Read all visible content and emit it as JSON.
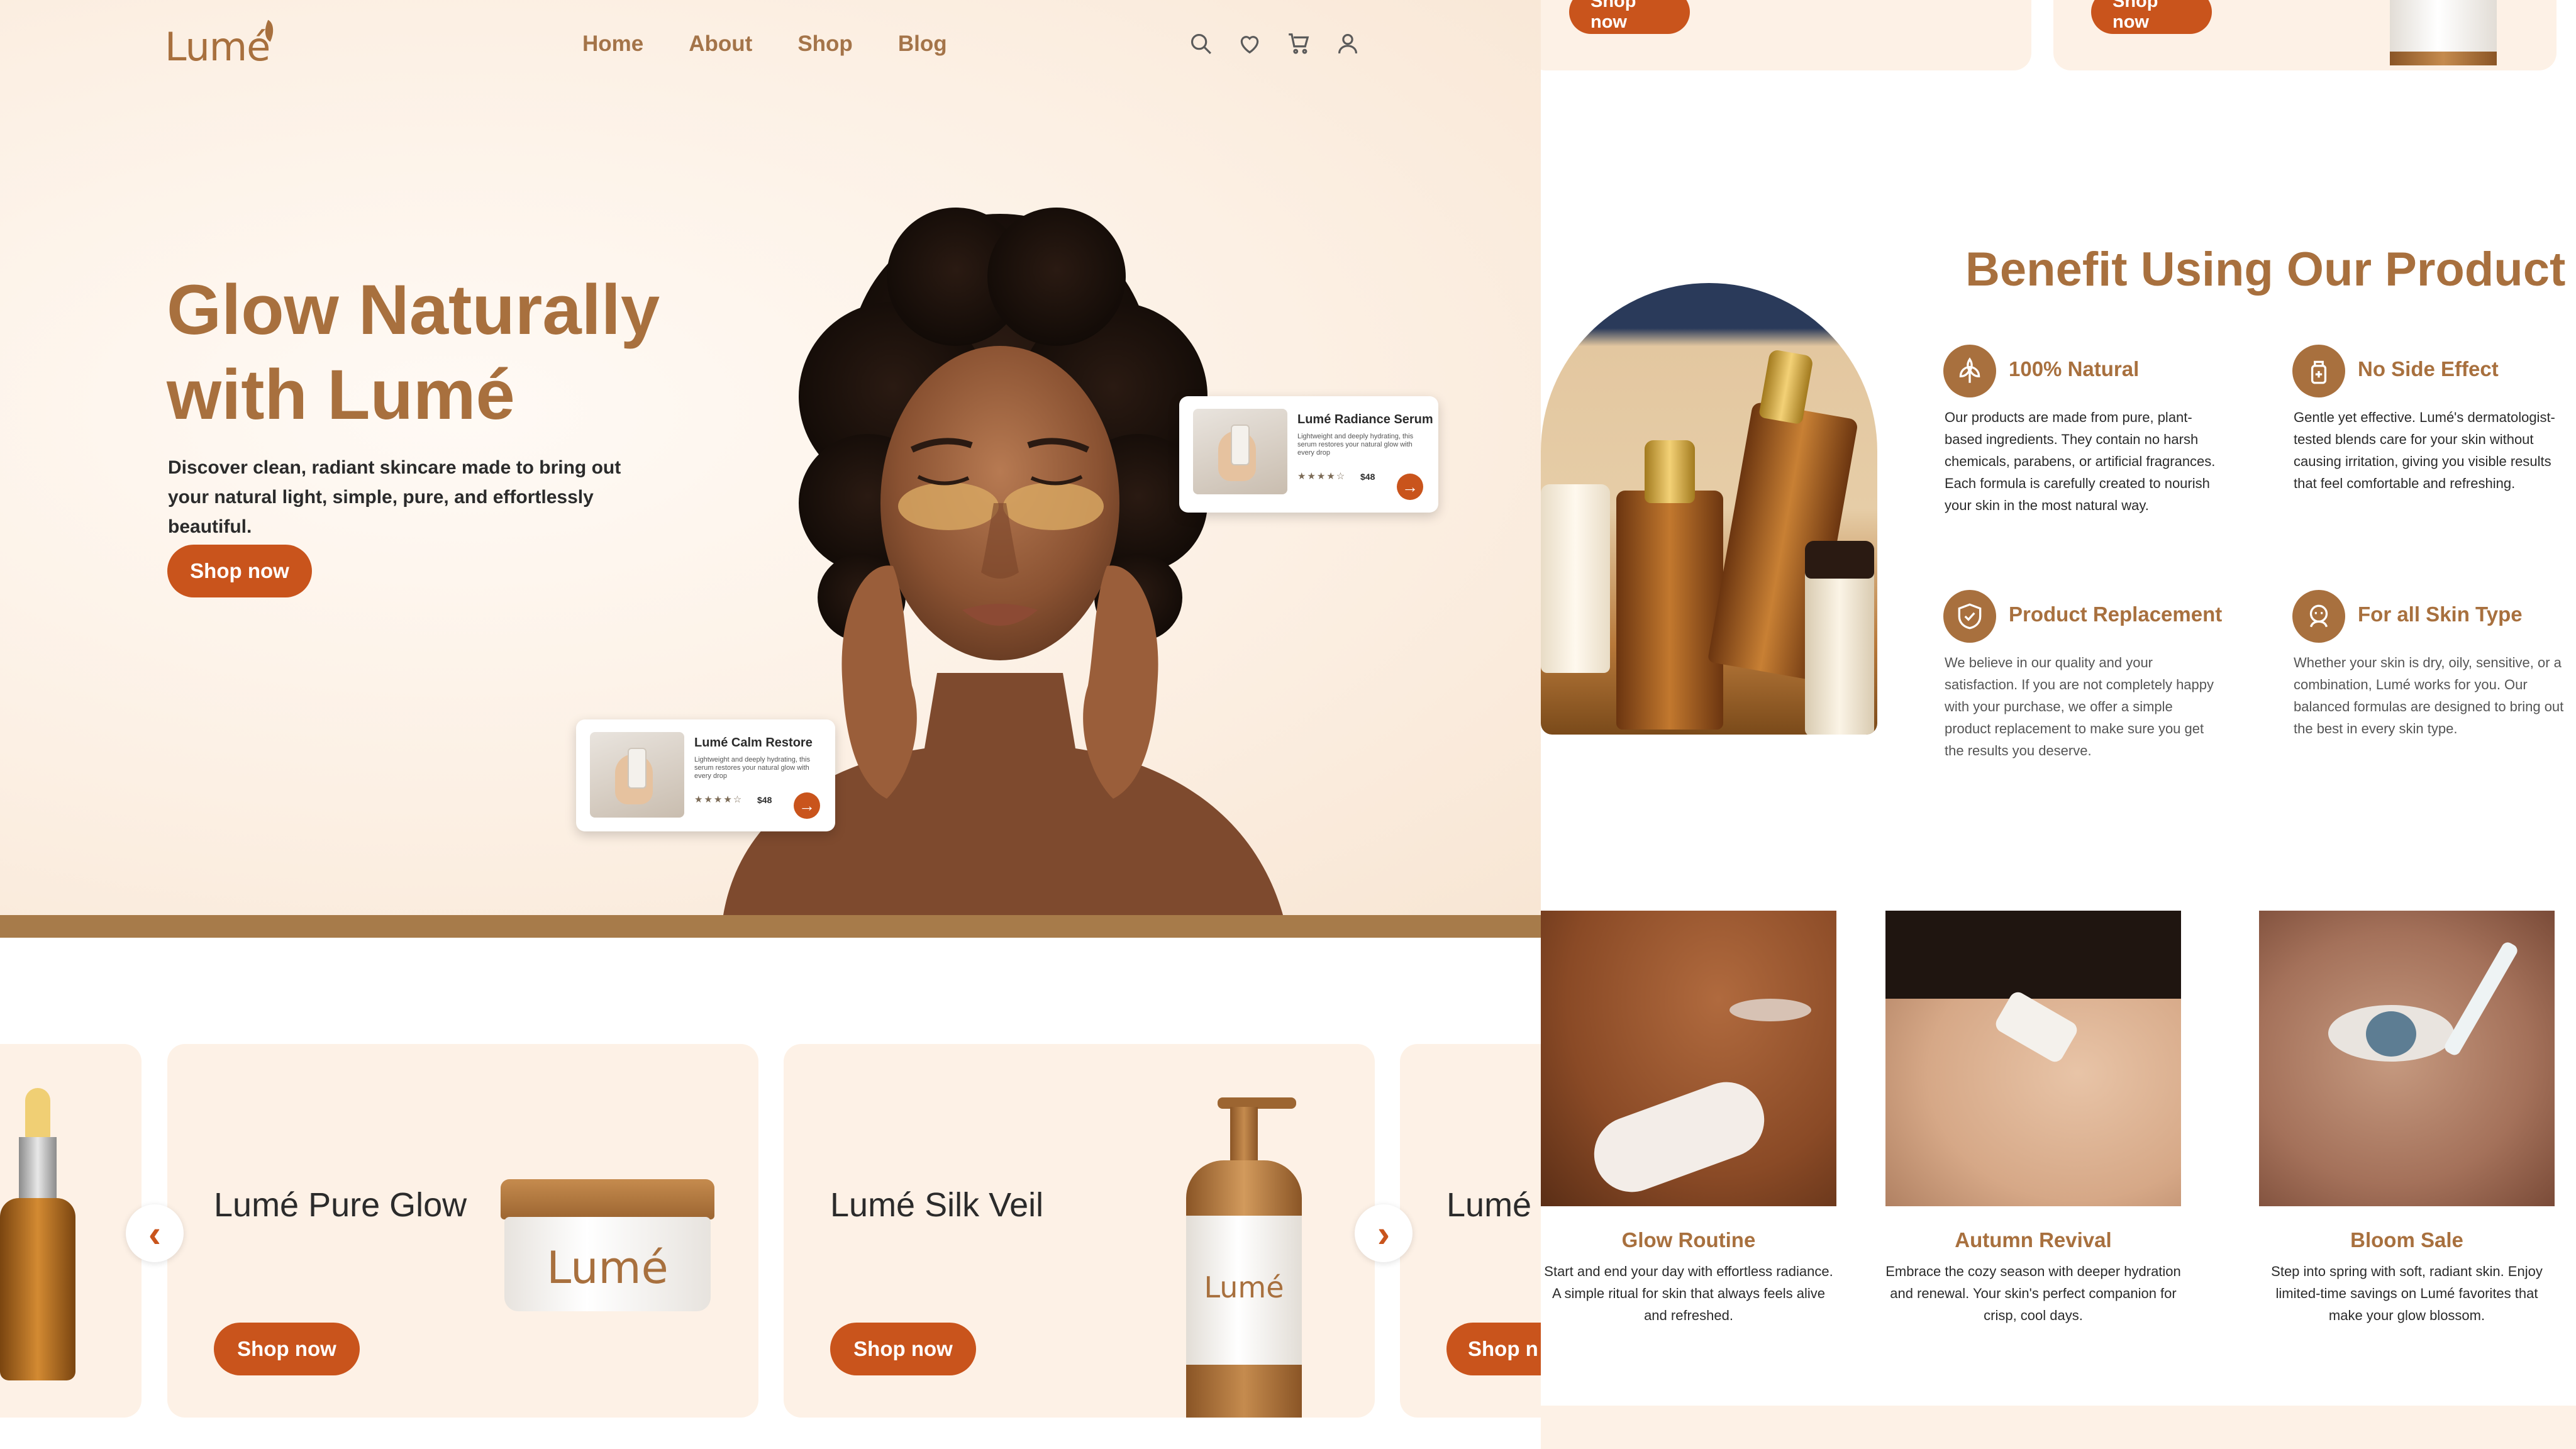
{
  "brand": {
    "logo": "Lumé"
  },
  "nav": {
    "items": [
      "Home",
      "About",
      "Shop",
      "Blog"
    ]
  },
  "nav_icons": [
    "search-icon",
    "heart-icon",
    "cart-icon",
    "user-icon"
  ],
  "hero": {
    "title_line1": "Glow Naturally",
    "title_line2": "with Lumé",
    "description": "Discover clean, radiant skincare made to bring out your natural light, simple, pure, and effortlessly beautiful.",
    "cta": "Shop now"
  },
  "floating_cards": [
    {
      "name": "Lumé Radiance Serum",
      "desc": "Lightweight and deeply hydrating, this serum restores your natural glow with every drop",
      "stars": "★★★★☆",
      "price": "$48"
    },
    {
      "name": "Lumé Calm Restore",
      "desc": "Lightweight and deeply hydrating, this serum restores your natural glow with every drop",
      "stars": "★★★★☆",
      "price": "$48"
    }
  ],
  "products": [
    {
      "name": "Lumé Pure Glow",
      "cta": "Shop now",
      "brand_mark": "Lumé"
    },
    {
      "name": "Lumé Silk Veil",
      "cta": "Shop now",
      "brand_mark": "Lumé"
    },
    {
      "name": "Lumé",
      "cta": "Shop n"
    }
  ],
  "carousel": {
    "prev": "‹",
    "next": "›"
  },
  "top_strip": {
    "cta_1": "Shop now",
    "cta_2": "Shop now"
  },
  "benefits": {
    "title": "Benefit Using Our Product",
    "items": [
      {
        "title": "100% Natural",
        "text": "Our products are made from pure, plant-based ingredients. They contain no harsh chemicals, parabens, or artificial fragrances. Each formula is carefully created to nourish your skin in the most natural way.",
        "icon": "leaf-icon"
      },
      {
        "title": "No Side Effect",
        "text": "Gentle yet effective. Lumé's dermatologist-tested blends care for your skin without causing irritation, giving you visible results that feel comfortable and refreshing.",
        "icon": "bottle-icon"
      },
      {
        "title": "Product Replacement",
        "text": "We believe in our quality and your satisfaction. If you are not completely happy with your purchase, we offer a simple product replacement to make sure you get the results you deserve.",
        "icon": "shield-icon"
      },
      {
        "title": "For all Skin Type",
        "text": "Whether your skin is dry, oily, sensitive, or a combination, Lumé works for you. Our balanced formulas are designed to bring out the best in every skin type.",
        "icon": "face-icon"
      }
    ]
  },
  "promos": [
    {
      "title": "Glow Routine",
      "text": "Start and end your day with effortless radiance. A simple ritual for skin that always feels alive and refreshed."
    },
    {
      "title": "Autumn Revival",
      "text": "Embrace the cozy season with deeper hydration and renewal. Your skin's perfect companion for crisp, cool days."
    },
    {
      "title": "Bloom Sale",
      "text": "Step into spring with soft, radiant skin. Enjoy limited-time savings on Lumé favorites that make your glow blossom."
    }
  ],
  "colors": {
    "brand": "#a8703e",
    "accent": "#c9541c",
    "cream": "#fdf1e6",
    "band": "#a77b4a"
  }
}
